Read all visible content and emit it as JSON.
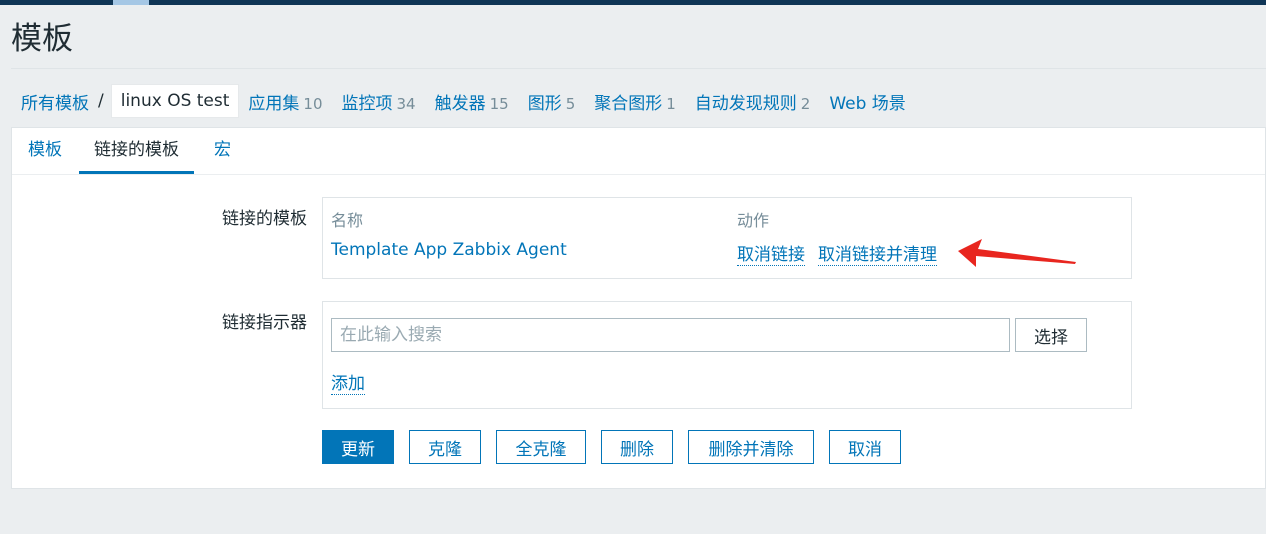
{
  "page": {
    "title": "模板"
  },
  "breadcrumbs": {
    "all_templates": "所有模板",
    "separator": "/",
    "current": "linux OS test",
    "items": [
      {
        "label": "应用集",
        "count": "10"
      },
      {
        "label": "监控项",
        "count": "34"
      },
      {
        "label": "触发器",
        "count": "15"
      },
      {
        "label": "图形",
        "count": "5"
      },
      {
        "label": "聚合图形",
        "count": "1"
      },
      {
        "label": "自动发现规则",
        "count": "2"
      },
      {
        "label": "Web 场景",
        "count": ""
      }
    ]
  },
  "tabs": [
    {
      "label": "模板",
      "active": false
    },
    {
      "label": "链接的模板",
      "active": true
    },
    {
      "label": "宏",
      "active": false
    }
  ],
  "linked_templates": {
    "label": "链接的模板",
    "col_name": "名称",
    "col_action": "动作",
    "rows": [
      {
        "name": "Template App Zabbix Agent",
        "unlink": "取消链接",
        "unlink_clear": "取消链接并清理"
      }
    ]
  },
  "link_indicator": {
    "label": "链接指示器",
    "placeholder": "在此输入搜索",
    "value": "",
    "select_label": "选择",
    "add_label": "添加"
  },
  "actions": {
    "update": "更新",
    "clone": "克隆",
    "full_clone": "全克隆",
    "delete": "删除",
    "delete_clear": "删除并清除",
    "cancel": "取消"
  },
  "colors": {
    "accent": "#0275b8",
    "annotation_arrow": "#e8261f"
  },
  "icons": {
    "annotation": "red-arrow-icon"
  }
}
